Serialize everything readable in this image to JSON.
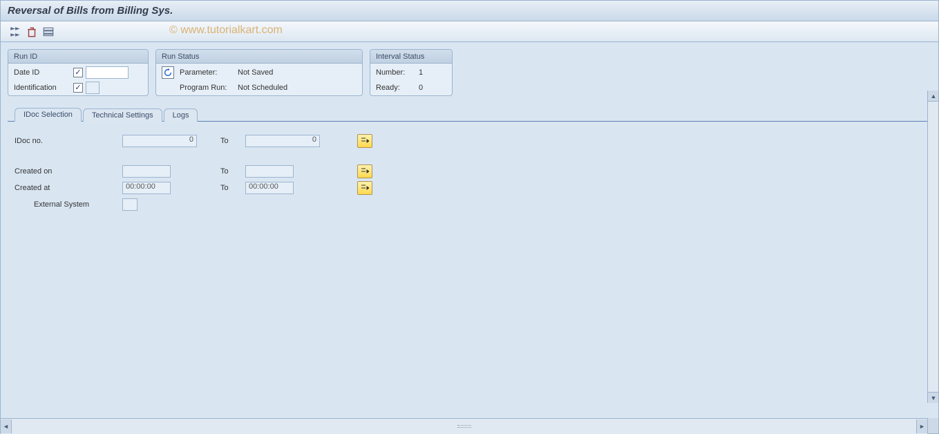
{
  "header": {
    "title": "Reversal of Bills from Billing Sys."
  },
  "watermark": "© www.tutorialkart.com",
  "panels": {
    "runid": {
      "title": "Run ID",
      "date_id_label": "Date ID",
      "date_id_value": "",
      "identification_label": "Identification",
      "identification_value": ""
    },
    "runstatus": {
      "title": "Run Status",
      "parameter_label": "Parameter:",
      "parameter_value": "Not Saved",
      "program_run_label": "Program Run:",
      "program_run_value": "Not Scheduled"
    },
    "interval": {
      "title": "Interval Status",
      "number_label": "Number:",
      "number_value": "1",
      "ready_label": "Ready:",
      "ready_value": "0"
    }
  },
  "tabs": {
    "idoc": "IDoc Selection",
    "tech": "Technical Settings",
    "logs": "Logs"
  },
  "selection": {
    "idoc_no_label": "IDoc no.",
    "idoc_no_from": "0",
    "idoc_no_to": "0",
    "to_label": "To",
    "created_on_label": "Created on",
    "created_on_from": "",
    "created_on_to": "",
    "created_at_label": "Created at",
    "created_at_from": "00:00:00",
    "created_at_to": "00:00:00",
    "ext_sys_label": "External System",
    "ext_sys_value": ""
  }
}
